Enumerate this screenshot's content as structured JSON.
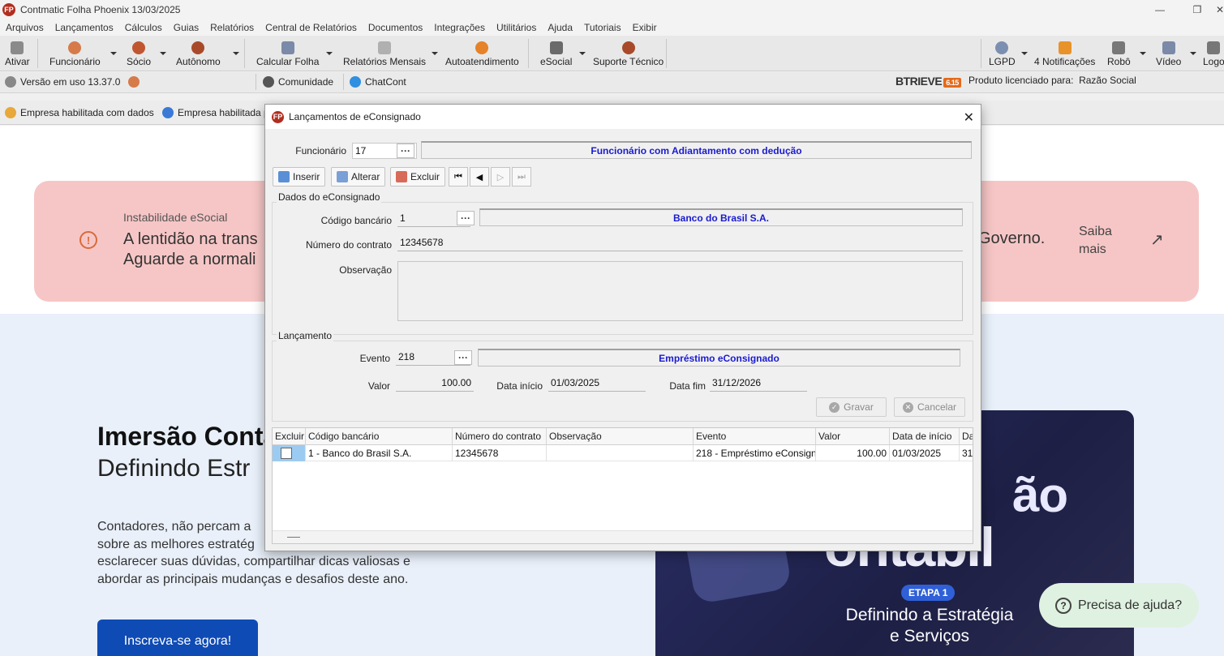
{
  "window": {
    "title": "Contmatic Folha Phoenix 13/03/2025",
    "logo_text": "FP"
  },
  "menu": [
    "Arquivos",
    "Lançamentos",
    "Cálculos",
    "Guias",
    "Relatórios",
    "Central de Relatórios",
    "Documentos",
    "Integrações",
    "Utilitários",
    "Ajuda",
    "Tutoriais",
    "Exibir"
  ],
  "toolbar": {
    "ativar": "Ativar",
    "funcionario": "Funcionário",
    "socio": "Sócio",
    "autonomo": "Autônomo",
    "calcular_folha": "Calcular Folha",
    "relatorios_mensais": "Relatórios Mensais",
    "autoatendimento": "Autoatendimento",
    "esocial": "eSocial",
    "suporte": "Suporte Técnico",
    "lgpd": "LGPD",
    "notificacoes": "4 Notificações",
    "robo": "Robô",
    "video": "Vídeo",
    "logout": "Logo"
  },
  "status": {
    "versao": "Versão em uso 13.37.0",
    "comunidade": "Comunidade",
    "chatcont": "ChatCont",
    "btrieve": "BTRIEVE",
    "btrieve_version": "6.15",
    "licenciado_label": "Produto licenciado para:",
    "licenciado_value": "Razão Social"
  },
  "company": {
    "item1": "Empresa habilitada com dados",
    "item2": "Empresa habilitada p"
  },
  "web": {
    "alert_small": "Instabilidade eSocial",
    "alert_line1": "A lentidão na trans",
    "alert_line2": "Aguarde a normali",
    "alert_right": "Governo.",
    "saiba_1": "Saiba",
    "saiba_2": "mais",
    "hero_title": "Imersão Conta",
    "hero_sub": "Definindo Estr",
    "hero_text_1": "Contadores, não percam a",
    "hero_text_2": "sobre as melhores estratég",
    "hero_text_3": "esclarecer suas dúvidas, compartilhar dicas valiosas e",
    "hero_text_4": "abordar as principais mudanças e desafios deste ano.",
    "cta": "Inscreva-se agora!",
    "banner_big1": "ão",
    "banner_big2": "ontábil",
    "banner_etapa": "ETAPA 1",
    "banner_sub1": "Definindo a Estratégia",
    "banner_sub2": "e Serviços",
    "help": "Precisa de ajuda?"
  },
  "dialog": {
    "title": "Lançamentos de eConsignado",
    "funcionario_label": "Funcionário",
    "funcionario_value": "17",
    "funcionario_desc": "Funcionário com Adiantamento com dedução",
    "buttons": {
      "inserir": "Inserir",
      "alterar": "Alterar",
      "excluir": "Excluir"
    },
    "dados_title": "Dados do eConsignado",
    "codigo_label": "Código bancário",
    "codigo_value": "1",
    "codigo_desc": "Banco do Brasil S.A.",
    "contrato_label": "Número do contrato",
    "contrato_value": "12345678",
    "observacao_label": "Observação",
    "observacao_value": "",
    "lancamento_title": "Lançamento",
    "evento_label": "Evento",
    "evento_value": "218",
    "evento_desc": "Empréstimo eConsignado",
    "valor_label": "Valor",
    "valor_value": "100.00",
    "data_inicio_label": "Data início",
    "data_inicio_value": "01/03/2025",
    "data_fim_label": "Data fim",
    "data_fim_value": "31/12/2026",
    "gravar": "Gravar",
    "cancelar": "Cancelar",
    "grid": {
      "headers": [
        "Excluir",
        "Código bancário",
        "Número do contrato",
        "Observação",
        "Evento",
        "Valor",
        "Data de início",
        "Da"
      ],
      "row": [
        "",
        "1 - Banco do Brasil S.A.",
        "12345678",
        "",
        "218 - Empréstimo eConsign",
        "100.00",
        "01/03/2025",
        "31,"
      ]
    }
  }
}
